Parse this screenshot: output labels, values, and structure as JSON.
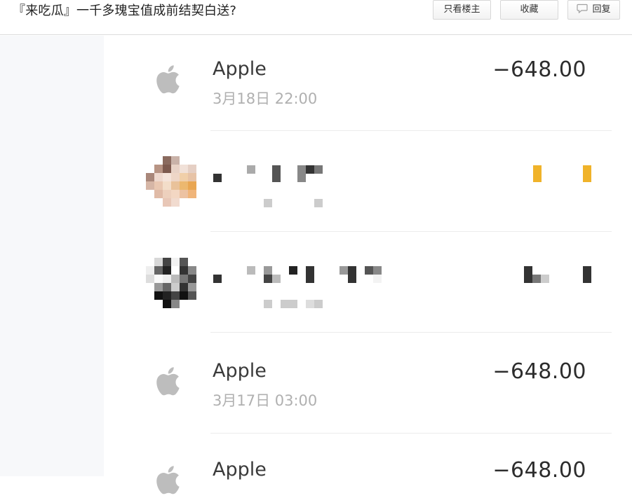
{
  "header": {
    "title": "『来吃瓜』一千多瑰宝值成前结契白送?",
    "buttons": {
      "only_author": "只看楼主",
      "favorite": "收藏",
      "reply": "回复"
    }
  },
  "transactions": [
    {
      "merchant": "Apple",
      "datetime": "3月18日 22:00",
      "amount": "−648.00"
    },
    {
      "merchant": "Apple",
      "datetime": "3月17日 03:00",
      "amount": "−648.00"
    },
    {
      "merchant": "Apple",
      "amount": "−648.00"
    }
  ],
  "colors": {
    "header_border": "#dcdcdc",
    "gutter": "#f7f8fa",
    "apple_gray": "#bdbdbd",
    "pixel_yellow": "#f0b32a"
  }
}
